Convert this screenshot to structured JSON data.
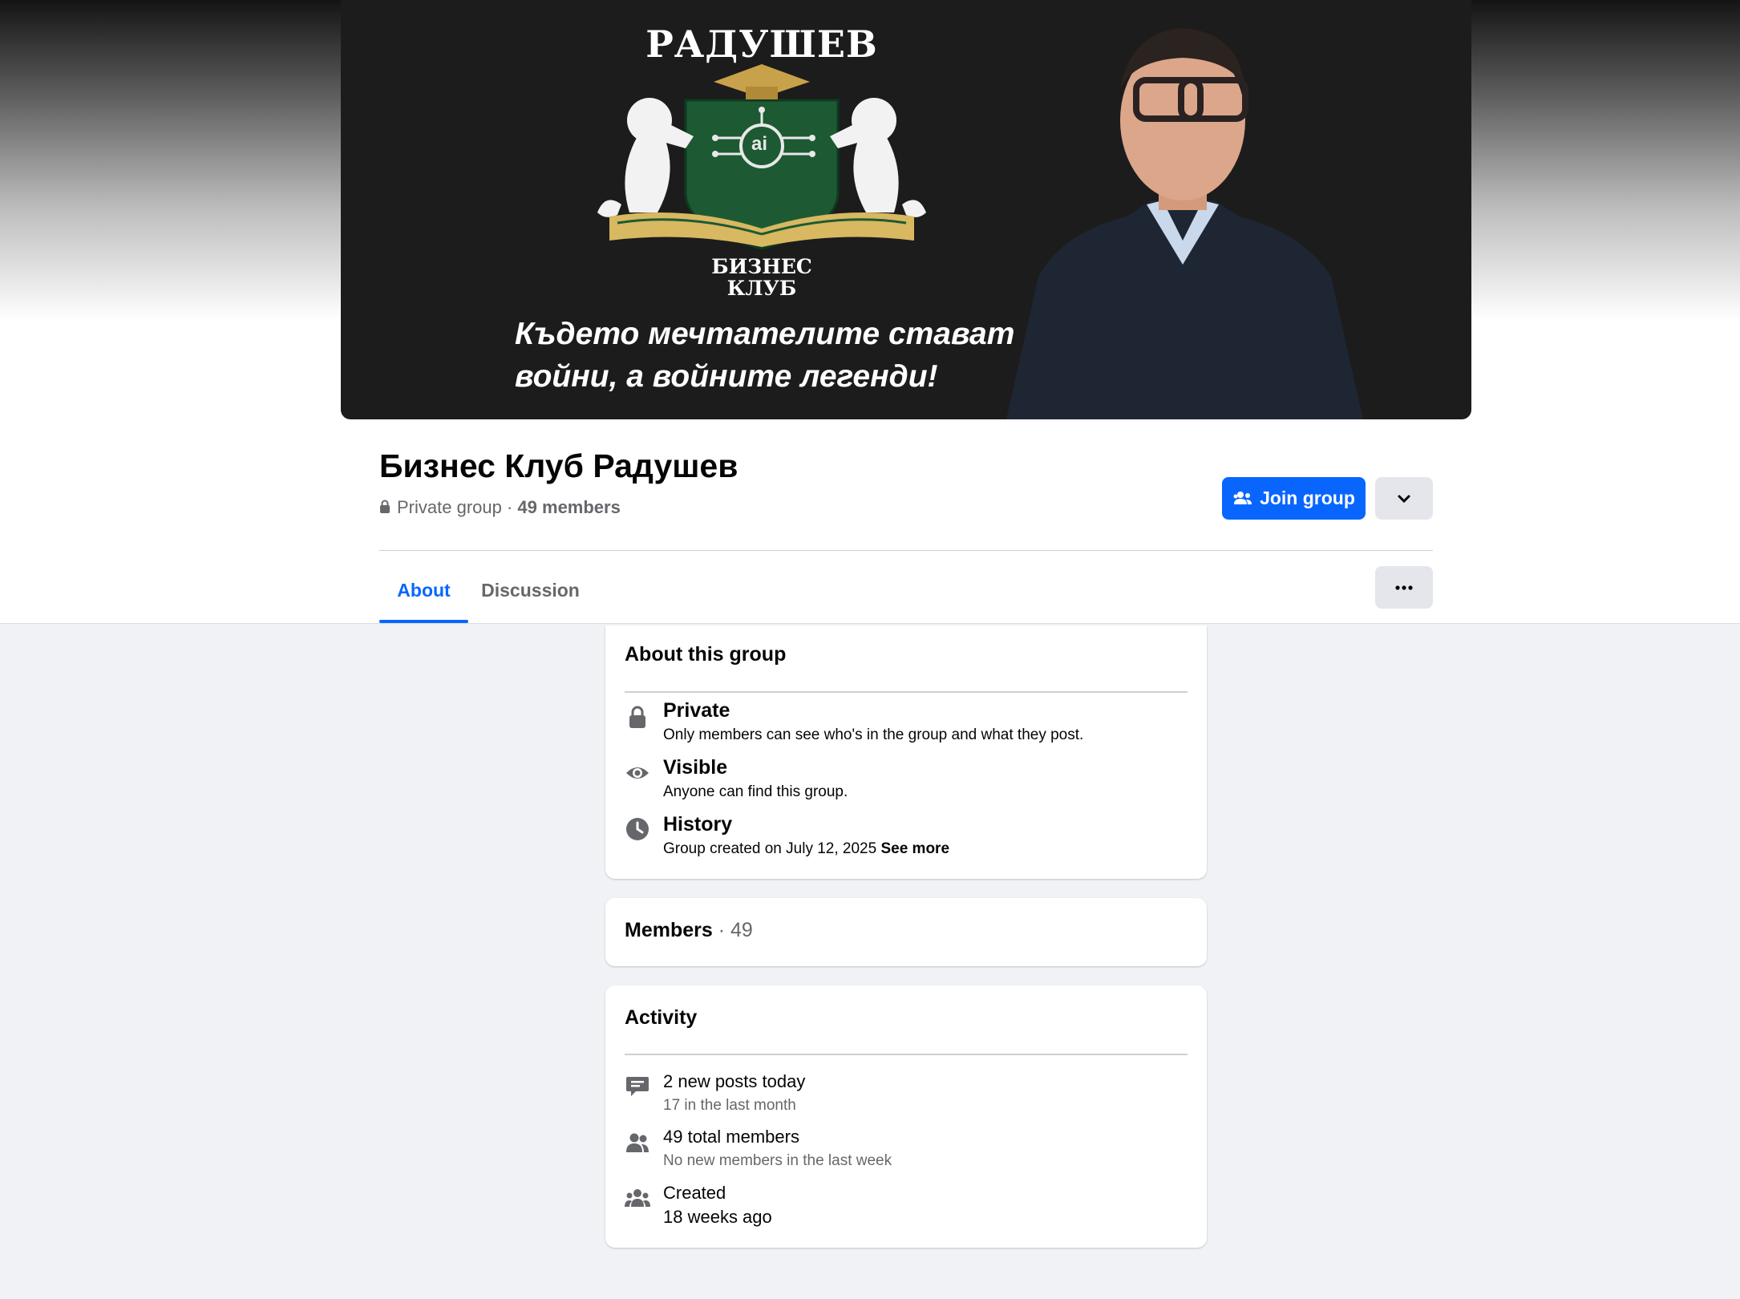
{
  "cover": {
    "logo_title": "РАДУШЕВ",
    "logo_sub_line1": "БИЗНЕС",
    "logo_sub_line2": "КЛУБ",
    "logo_emblem_text": "ai",
    "slogan_line1": "Където мечтателите стават",
    "slogan_line2": "войни, а войните легенди!"
  },
  "group": {
    "name": "Бизнес Клуб Радушев",
    "privacy": "Private group",
    "separator": " · ",
    "members": "49 members"
  },
  "actions": {
    "join_label": "Join group"
  },
  "tabs": [
    {
      "label": "About",
      "active": true
    },
    {
      "label": "Discussion",
      "active": false
    }
  ],
  "about": {
    "title": "About this group",
    "rows": [
      {
        "icon": "lock-icon",
        "title": "Private",
        "desc": "Only members can see who's in the group and what they post."
      },
      {
        "icon": "eye-icon",
        "title": "Visible",
        "desc": "Anyone can find this group."
      },
      {
        "icon": "clock-icon",
        "title": "History",
        "desc": "Group created on July 12, 2025",
        "link": "See more"
      }
    ]
  },
  "members_card": {
    "title": "Members",
    "separator": " · ",
    "count": "49"
  },
  "activity": {
    "title": "Activity",
    "rows": [
      {
        "icon": "chat-icon",
        "title": "2 new posts today",
        "sub": "17 in the last month"
      },
      {
        "icon": "members-icon",
        "title": "49 total members",
        "sub": "No new members in the last week"
      },
      {
        "icon": "group-icon",
        "title": "Created",
        "sub": "18 weeks ago"
      }
    ]
  },
  "colors": {
    "accent": "#0866ff",
    "background": "#f0f2f5",
    "secondary_text": "#65676b",
    "button_gray": "#e4e6eb"
  }
}
